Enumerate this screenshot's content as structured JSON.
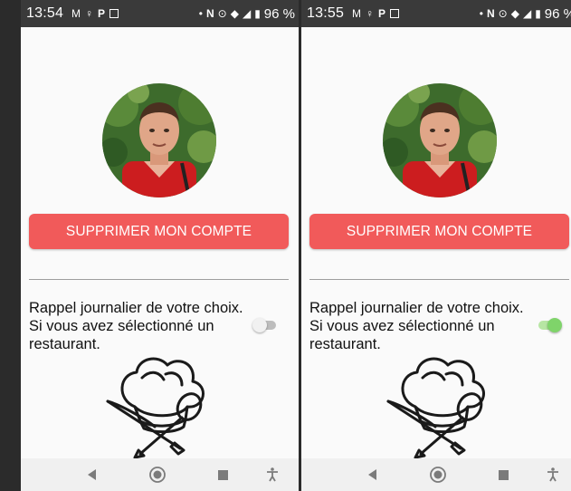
{
  "screens": [
    {
      "status_bar": {
        "time": "13:54",
        "battery": "96 %",
        "icons": [
          "gmail-icon",
          "lightbulb-icon",
          "p-icon",
          "image-icon",
          "dot-icon",
          "nfc-icon",
          "location-icon",
          "wifi-icon",
          "signal-icon",
          "battery-icon"
        ]
      },
      "profile": {
        "avatar": "user-photo"
      },
      "delete_button_label": "SUPPRIMER MON COMPTE",
      "reminder": {
        "line1": "Rappel journalier de votre choix.",
        "line2": "Si vous avez sélectionné un",
        "line3": "restaurant.",
        "enabled": false
      },
      "logo": "chef-hat-cutlery-icon",
      "nav": [
        "back-icon",
        "home-icon",
        "recents-icon",
        "accessibility-icon"
      ]
    },
    {
      "status_bar": {
        "time": "13:55",
        "battery": "96 %",
        "icons": [
          "gmail-icon",
          "lightbulb-icon",
          "p-icon",
          "image-icon",
          "dot-icon",
          "nfc-icon",
          "location-icon",
          "wifi-icon",
          "signal-icon",
          "battery-icon"
        ]
      },
      "profile": {
        "avatar": "user-photo"
      },
      "delete_button_label": "SUPPRIMER MON COMPTE",
      "reminder": {
        "line1": "Rappel journalier de votre choix.",
        "line2": "Si vous avez sélectionné un",
        "line3": "restaurant.",
        "enabled": true
      },
      "logo": "chef-hat-cutlery-icon",
      "nav": [
        "back-icon",
        "home-icon",
        "recents-icon",
        "accessibility-icon"
      ]
    }
  ],
  "colors": {
    "button": "#f15a5a",
    "toggle_on": "#7fd46a",
    "toggle_off": "#f1f1f1",
    "status_bar": "#3a3a3a",
    "background": "#fafafa"
  }
}
